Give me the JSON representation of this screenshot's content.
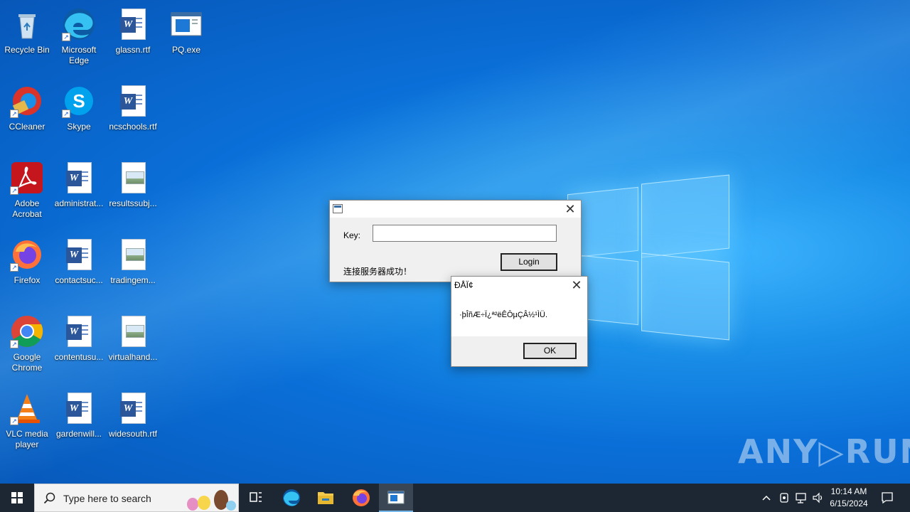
{
  "desktop": {
    "icons": [
      {
        "label": "Recycle Bin"
      },
      {
        "label": "Microsoft Edge"
      },
      {
        "label": "glassn.rtf"
      },
      {
        "label": "PQ.exe"
      },
      {
        "label": "CCleaner"
      },
      {
        "label": "Skype"
      },
      {
        "label": "ncschools.rtf"
      },
      {
        "label": "Adobe Acrobat"
      },
      {
        "label": "administrat..."
      },
      {
        "label": "resultssubj..."
      },
      {
        "label": "Firefox"
      },
      {
        "label": "contactsuc..."
      },
      {
        "label": "tradingem..."
      },
      {
        "label": "Google Chrome"
      },
      {
        "label": "contentusu..."
      },
      {
        "label": "virtualhand..."
      },
      {
        "label": "VLC media player"
      },
      {
        "label": "gardenwill..."
      },
      {
        "label": "widesouth.rtf"
      }
    ]
  },
  "login_dialog": {
    "key_label": "Key:",
    "key_value": "",
    "login_button": "Login",
    "status_text": "连接服务器成功！",
    "close_glyph": "✕"
  },
  "message_dialog": {
    "title": "ÐÅÏ¢",
    "message": "·þÎñÆ÷Ï¿ª²ëÊÔµÇÂ½¹ÌÜ.",
    "ok_button": "OK",
    "close_glyph": "✕"
  },
  "watermark": "ANY▷RUN",
  "taskbar": {
    "search_placeholder": "Type here to search",
    "clock_time": "10:14 AM",
    "clock_date": "6/15/2024"
  }
}
